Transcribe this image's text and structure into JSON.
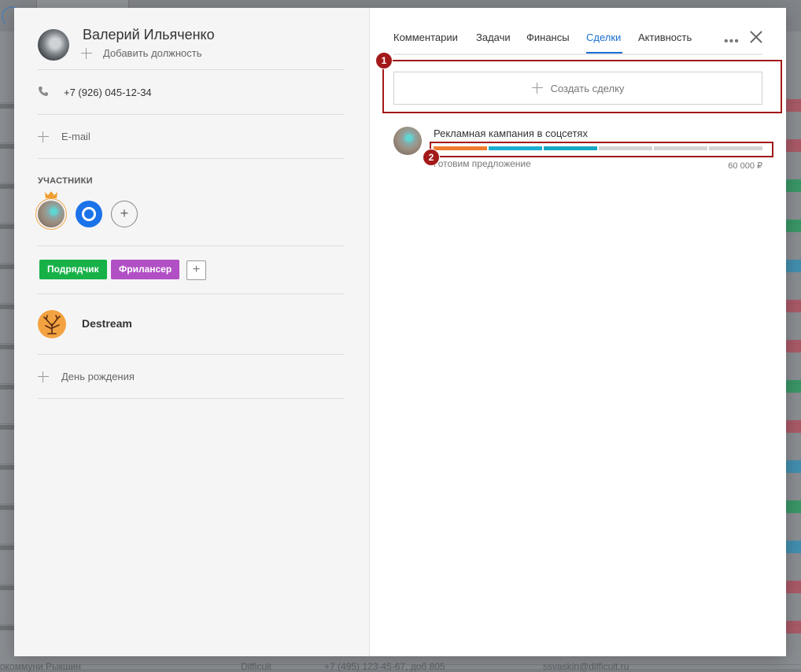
{
  "contact": {
    "name": "Валерий Ильяченко",
    "add_position_label": "Добавить должность",
    "phone": "+7 (926) 045-12-34",
    "email_label": "E-mail",
    "participants_label": "УЧАСТНИКИ",
    "tags": [
      "Подрядчик",
      "Фрилансер"
    ],
    "company_name": "Destream",
    "birthday_label": "День рождения"
  },
  "tabs": [
    "Комментарии",
    "Задачи",
    "Финансы",
    "Сделки",
    "Активность"
  ],
  "active_tab": "Сделки",
  "create_deal_label": "Создать сделку",
  "deal": {
    "title": "Рекламная кампания в соцсетях",
    "status": "Готовим предложение",
    "amount": "60 000 ₽",
    "stage_colors": [
      "#ef7d30",
      "#1aaed0",
      "#16a8c2",
      "#d4d4d4",
      "#d4d4d4",
      "#d4d4d4"
    ]
  },
  "markers": [
    "1",
    "2"
  ],
  "background": {
    "bottom_row": [
      "окоммуни Рыкшин",
      "Difficult",
      "+7 (495) 123-45-67, доб 805",
      "ssvaskin@difficult.ru"
    ],
    "tag_colors": [
      "#b34a5a",
      "#b34a5a",
      "#1f9a5a",
      "#1f9a5a",
      "#2b8fb8",
      "#b34a5a",
      "#b34a5a",
      "#1f9a5a",
      "#b34a5a",
      "#2b8fb8",
      "#1f9a5a",
      "#2b8fb8",
      "#b34a5a",
      "#b34a5a"
    ]
  },
  "colors": {
    "accent": "#1a6fcf",
    "tag_contractor": "#17b148",
    "tag_freelancer": "#b14fc4",
    "highlight": "#a31919"
  }
}
